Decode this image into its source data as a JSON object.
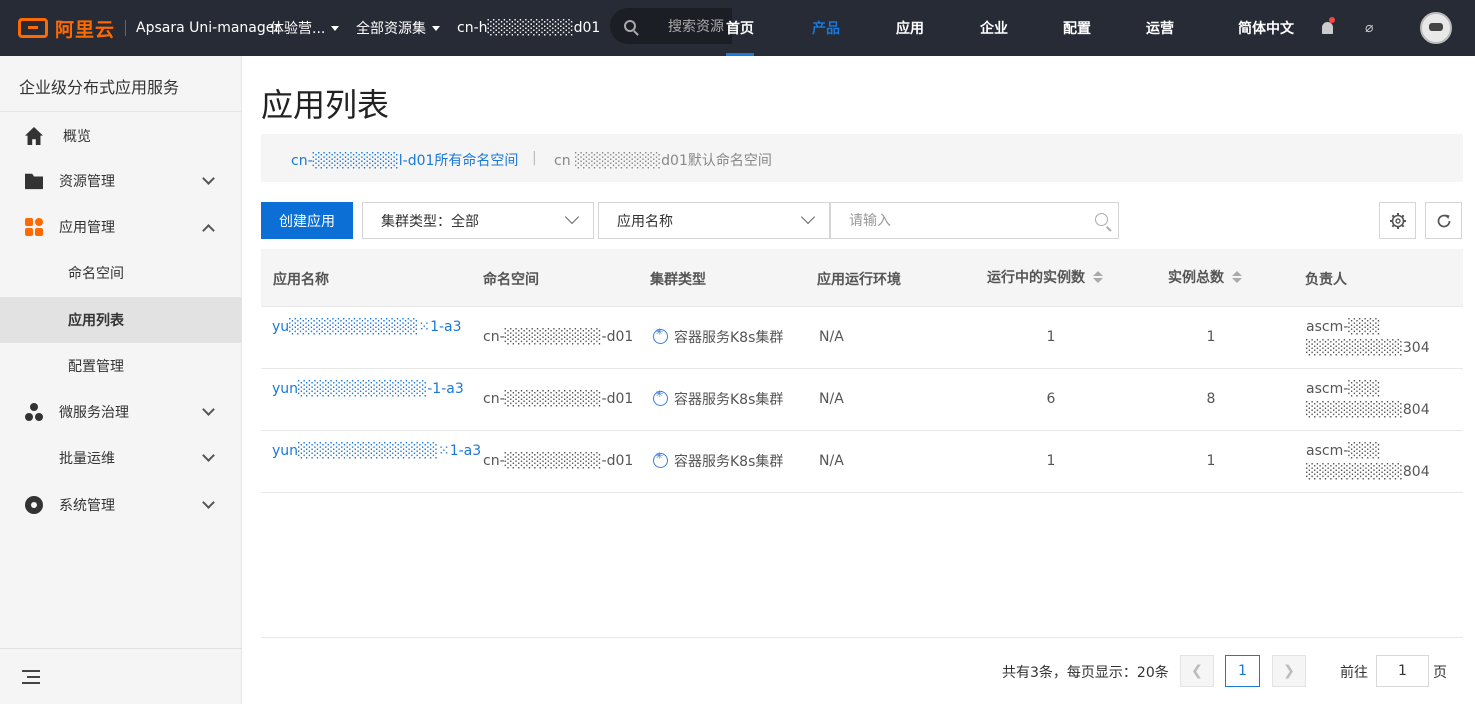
{
  "topbar": {
    "logo_cn": "阿里云",
    "logo_en": "Apsara Uni-manager",
    "org": "体验营...",
    "resource_set": "全部资源集",
    "region": "cn-h░░░░░░░░d01",
    "search_placeholder": "搜索资源",
    "nav": [
      "首页",
      "产品",
      "应用",
      "企业",
      "配置",
      "运营"
    ],
    "language": "简体中文"
  },
  "sidebar": {
    "title": "企业级分布式应用服务",
    "items": [
      {
        "label": "概览",
        "icon": "home-icon"
      },
      {
        "label": "资源管理",
        "icon": "folder-icon"
      },
      {
        "label": "应用管理",
        "icon": "apps-icon"
      },
      {
        "label": "命名空间"
      },
      {
        "label": "应用列表"
      },
      {
        "label": "配置管理"
      },
      {
        "label": "微服务治理",
        "icon": "microservice-icon"
      },
      {
        "label": "批量运维"
      },
      {
        "label": "系统管理",
        "icon": "gear-icon"
      }
    ]
  },
  "main": {
    "title": "应用列表",
    "ns_link_all": "cn-░░░░░░░░l-d01所有命名空间",
    "ns_sep": "|",
    "ns_link_default": "cn ░░░░░░░░d01默认命名空间",
    "create_button": "创建应用",
    "cluster_filter": "集群类型：全部",
    "field_filter": "应用名称",
    "search_placeholder": "请输入"
  },
  "table": {
    "columns": [
      "应用名称",
      "命名空间",
      "集群类型",
      "应用运行环境",
      "运行中的实例数",
      "实例总数",
      "负责人"
    ],
    "rows": [
      {
        "name": "yu░░░░░░░░░░░░⁙1-a3",
        "namespace": "cn-░░░░░░░░░-d01",
        "cluster": "容器服务K8s集群",
        "env": "N/A",
        "running": "1",
        "total": "1",
        "owner1": "ascm-░░░",
        "owner2": "░░░░░░░░░304"
      },
      {
        "name": "yun░░░░░░░░░░░░-1-a3",
        "namespace": "cn-░░░░░░░░░-d01",
        "cluster": "容器服务K8s集群",
        "env": "N/A",
        "running": "6",
        "total": "8",
        "owner1": "ascm-░░░",
        "owner2": "░░░░░░░░░804"
      },
      {
        "name": "yun░░░░░░░░░░░░░⁙1-a3",
        "namespace": "cn-░░░░░░░░░-d01",
        "cluster": "容器服务K8s集群",
        "env": "N/A",
        "running": "1",
        "total": "1",
        "owner1": "ascm-░░░",
        "owner2": "░░░░░░░░░804"
      }
    ]
  },
  "pagination": {
    "summary": "共有3条，每页显示：20条",
    "current_page": "1",
    "goto_label": "前往",
    "goto_value": "1",
    "page_unit": "页"
  },
  "colors": {
    "topbar_bg": "#272b35",
    "accent": "#1a78d8",
    "brand": "#ff6a00"
  }
}
